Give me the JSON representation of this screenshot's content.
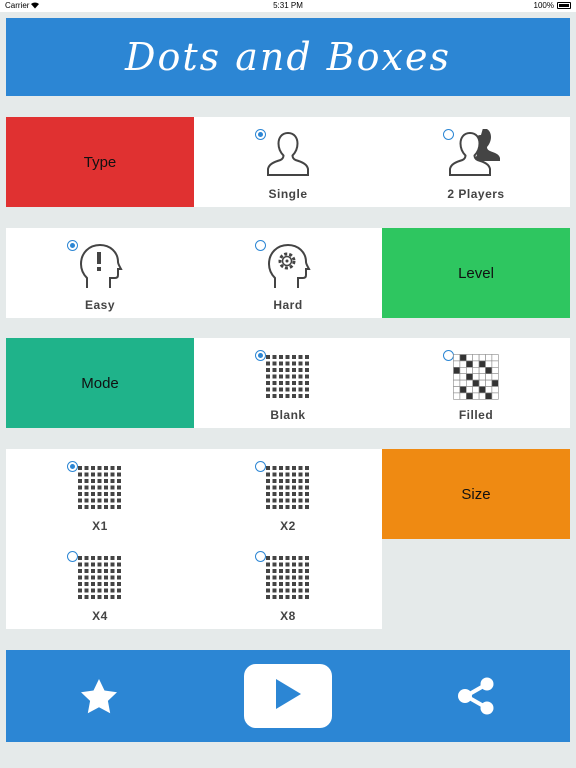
{
  "status_bar": {
    "carrier": "Carrier",
    "time": "5:31 PM",
    "battery": "100%"
  },
  "title": "Dots and Boxes",
  "type_section": {
    "label": "Type",
    "color": "#e03131",
    "options": [
      {
        "label": "Single",
        "selected": true,
        "icon": "single-user-icon"
      },
      {
        "label": "2 Players",
        "selected": false,
        "icon": "two-players-icon"
      }
    ]
  },
  "level_section": {
    "label": "Level",
    "color": "#2ec660",
    "options": [
      {
        "label": "Easy",
        "selected": true,
        "icon": "head-exclamation-icon"
      },
      {
        "label": "Hard",
        "selected": false,
        "icon": "head-gear-icon"
      }
    ]
  },
  "mode_section": {
    "label": "Mode",
    "color": "#1fb38a",
    "options": [
      {
        "label": "Blank",
        "selected": true,
        "icon": "dot-grid-icon"
      },
      {
        "label": "Filled",
        "selected": false,
        "icon": "filled-grid-icon"
      }
    ]
  },
  "size_section": {
    "label": "Size",
    "color": "#ef8a12",
    "options": [
      {
        "label": "X1",
        "selected": true,
        "icon": "dot-grid-icon"
      },
      {
        "label": "X2",
        "selected": false,
        "icon": "dot-grid-icon"
      },
      {
        "label": "X4",
        "selected": false,
        "icon": "dot-grid-icon"
      },
      {
        "label": "X8",
        "selected": false,
        "icon": "dot-grid-icon"
      }
    ]
  },
  "bottom_bar": {
    "left_icon": "star-icon",
    "center_icon": "play-icon",
    "right_icon": "share-icon",
    "color": "#2c86d4"
  }
}
